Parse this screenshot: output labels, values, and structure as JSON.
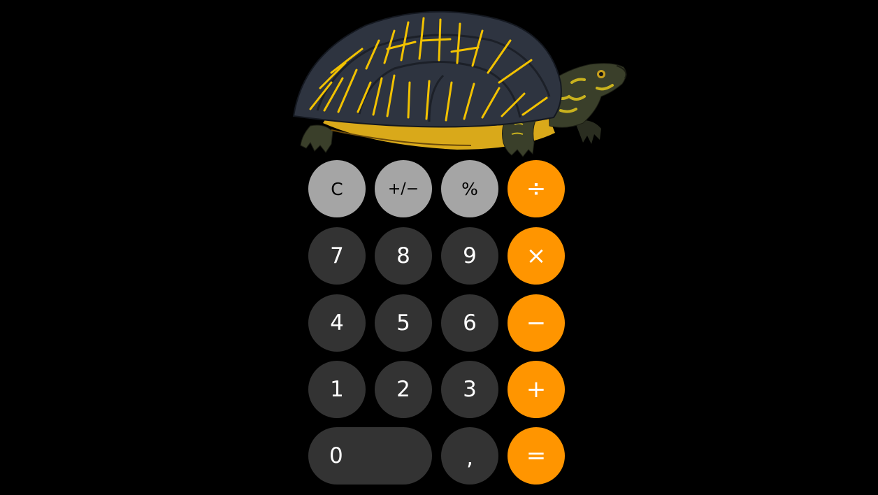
{
  "illustration": {
    "subject": "box-turtle",
    "colors": {
      "shell_dark": "#2e3440",
      "shell_line": "#f2c200",
      "plastron": "#d9a91a",
      "skin": "#3a3f2a",
      "skin_spots": "#c9b21e"
    }
  },
  "keypad": {
    "rows": [
      [
        {
          "id": "clear",
          "label": "C",
          "kind": "fn"
        },
        {
          "id": "sign",
          "label": "+/−",
          "kind": "fn"
        },
        {
          "id": "percent",
          "label": "%",
          "kind": "fn"
        },
        {
          "id": "divide",
          "label": "÷",
          "kind": "op"
        }
      ],
      [
        {
          "id": "7",
          "label": "7",
          "kind": "num"
        },
        {
          "id": "8",
          "label": "8",
          "kind": "num"
        },
        {
          "id": "9",
          "label": "9",
          "kind": "num"
        },
        {
          "id": "multiply",
          "label": "×",
          "kind": "op"
        }
      ],
      [
        {
          "id": "4",
          "label": "4",
          "kind": "num"
        },
        {
          "id": "5",
          "label": "5",
          "kind": "num"
        },
        {
          "id": "6",
          "label": "6",
          "kind": "num"
        },
        {
          "id": "subtract",
          "label": "−",
          "kind": "op"
        }
      ],
      [
        {
          "id": "1",
          "label": "1",
          "kind": "num"
        },
        {
          "id": "2",
          "label": "2",
          "kind": "num"
        },
        {
          "id": "3",
          "label": "3",
          "kind": "num"
        },
        {
          "id": "add",
          "label": "+",
          "kind": "op"
        }
      ],
      [
        {
          "id": "0",
          "label": "0",
          "kind": "num"
        },
        {
          "id": "comma",
          "label": ",",
          "kind": "num"
        },
        {
          "id": "equals",
          "label": "=",
          "kind": "op"
        }
      ]
    ],
    "colors": {
      "fn": "#a5a5a5",
      "num": "#333333",
      "op": "#ff9500",
      "background": "#000000"
    }
  }
}
